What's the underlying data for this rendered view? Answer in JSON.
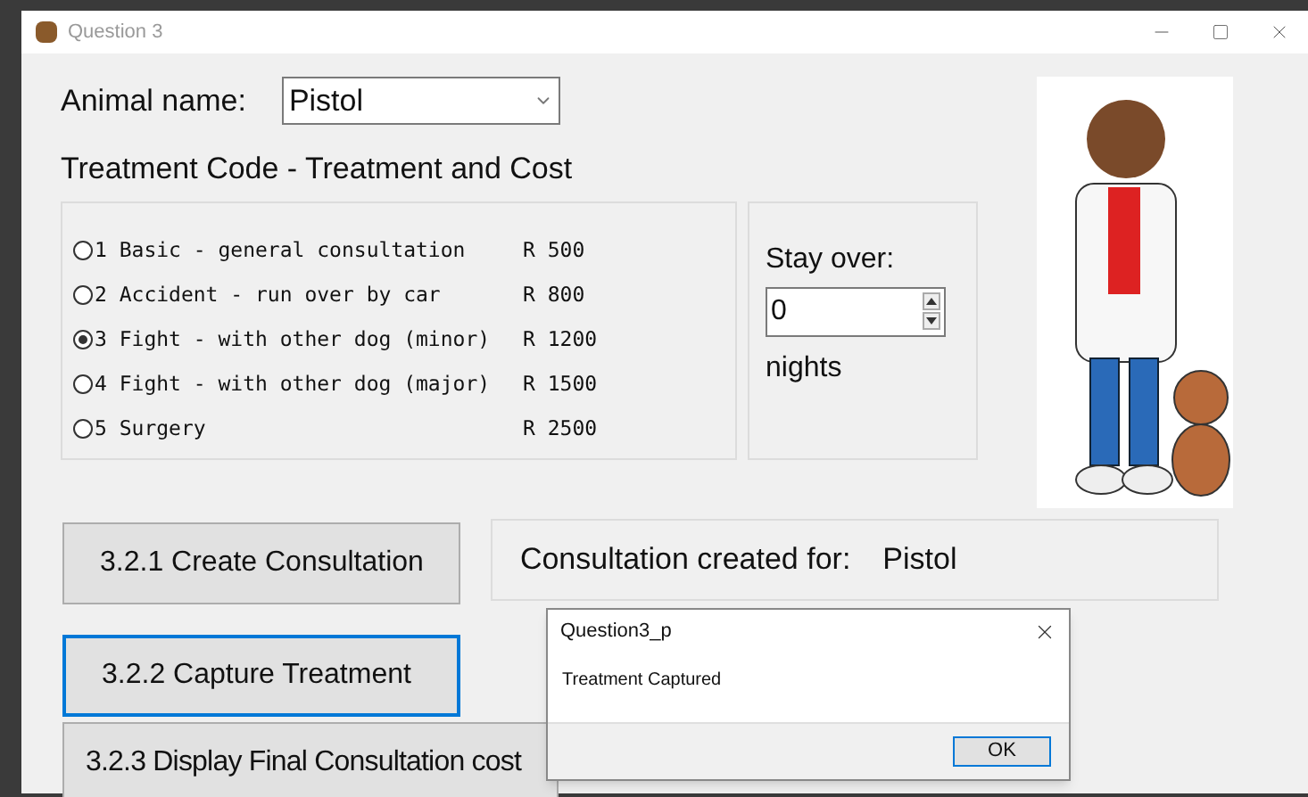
{
  "window": {
    "title": "Question 3"
  },
  "animal": {
    "label": "Animal name:",
    "value": "Pistol"
  },
  "treatment_heading": "Treatment Code - Treatment and Cost",
  "treatments": [
    {
      "code": "1",
      "name": "Basic - general consultation",
      "cost": "R 500",
      "selected": false
    },
    {
      "code": "2",
      "name": "Accident - run over by car",
      "cost": "R 800",
      "selected": false
    },
    {
      "code": "3",
      "name": "Fight - with other dog (minor)",
      "cost": "R 1200",
      "selected": true
    },
    {
      "code": "4",
      "name": "Fight - with other dog (major)",
      "cost": "R 1500",
      "selected": false
    },
    {
      "code": "5",
      "name": "Surgery",
      "cost": "R 2500",
      "selected": false
    }
  ],
  "stay": {
    "label": "Stay over:",
    "value": "0",
    "unit": "nights"
  },
  "buttons": [
    {
      "label": "3.2.1 Create Consultation",
      "focused": false
    },
    {
      "label": "3.2.2 Capture Treatment",
      "focused": true
    },
    {
      "label": "3.2.3 Display Final Consultation cost",
      "focused": false
    }
  ],
  "consultation": {
    "label": "Consultation created for:",
    "value": "Pistol"
  },
  "dialog": {
    "title": "Question3_p",
    "message": "Treatment Captured",
    "button": "OK"
  }
}
